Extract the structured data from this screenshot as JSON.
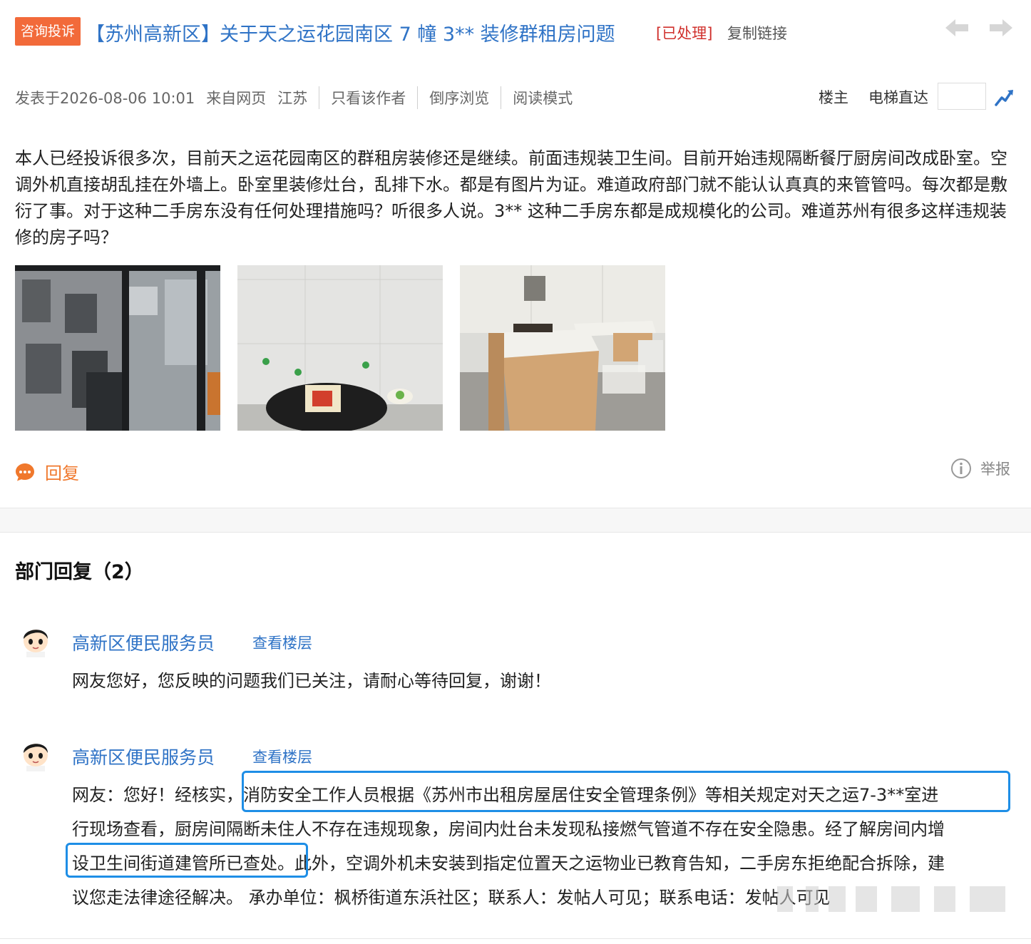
{
  "post": {
    "tag": "咨询投诉",
    "region": "【苏州高新区】",
    "title": "关于天之运花园南区 7 幢 3** 装修群租房问题",
    "status": "[已处理]",
    "copy_link": "复制链接",
    "meta": {
      "posted": "发表于2026-08-06 10:01",
      "source": "来自网页",
      "province": "江苏",
      "only_author": "只看该作者",
      "reverse": "倒序浏览",
      "read_mode": "阅读模式",
      "floor_owner": "楼主",
      "elevator": "电梯直达"
    },
    "body": "本人已经投诉很多次，目前天之运花园南区的群租房装修还是继续。前面违规装卫生间。目前开始违规隔断餐厅厨房间改成卧室。空调外机直接胡乱挂在外墙上。卧室里装修灶台，乱排下水。都是有图片为证。难道政府部门就不能认认真真的来管管吗。每次都是敷衍了事。对于这种二手房东没有任何处理措施吗？听很多人说。3** 这种二手房东都是成规模化的公司。难道苏州有很多这样违规装修的房子吗？",
    "reply": "回复",
    "report": "举报"
  },
  "dept": {
    "title": "部门回复（2）",
    "replies": [
      {
        "name": "高新区便民服务员",
        "view_floor": "查看楼层",
        "content": "网友您好，您反映的问题我们已关注，请耐心等待回复，谢谢！"
      },
      {
        "name": "高新区便民服务员",
        "view_floor": "查看楼层",
        "content_a": "网友：您好！经核实，",
        "content_b": "消防安全工作人员根据《苏州市出租房屋居住安全管理条例》等相关规定对天之运7-3**室进",
        "content_c": "行现场查看，厨房间隔断未住人不存在违规现象，房间内灶台未发现私接燃气管道不存在安全隐患。经了解房间内增",
        "content_d": "设卫生间街道建管所已查处。",
        "content_e": "此外，空调外机未安装到指定位置天之运物业已教育告知，二手房东拒绝配合拆除，建",
        "content_f": "议您走法律途径解决。 承办单位：枫桥街道东浜社区；联系人：发帖人可见；联系电话：发帖人可见"
      }
    ]
  },
  "colors": {
    "link_blue": "#2f73c6",
    "tag_orange": "#f26a3a",
    "status_red": "#d0312d",
    "reply_orange": "#f0782c",
    "highlight_blue": "#1e8ee6"
  }
}
